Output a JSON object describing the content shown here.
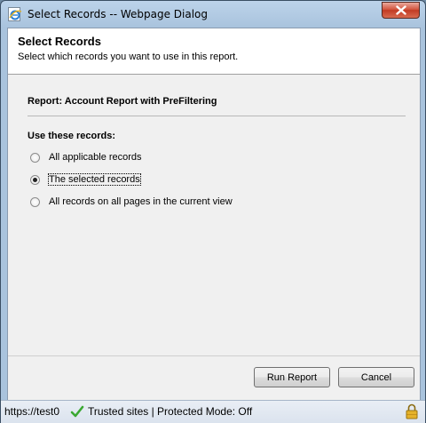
{
  "window": {
    "title": "Select Records -- Webpage Dialog"
  },
  "header": {
    "title": "Select Records",
    "description": "Select which records you want to use in this report."
  },
  "report": {
    "label": "Report: Account Report with PreFiltering"
  },
  "records": {
    "heading": "Use these records:",
    "options": [
      {
        "label": "All applicable records",
        "checked": false
      },
      {
        "label": "The selected records",
        "checked": true
      },
      {
        "label": "All records on all pages in the current view",
        "checked": false
      }
    ]
  },
  "buttons": {
    "run_report": "Run Report",
    "cancel": "Cancel"
  },
  "status": {
    "url": "https://test0",
    "zone": "Trusted sites | Protected Mode: Off"
  },
  "icons": {
    "title_icon": "ie-icon",
    "close": "close-icon",
    "check": "check-icon",
    "lock": "lock-icon"
  },
  "colors": {
    "close_button": "#c23b23",
    "trusted_check": "#3aa832",
    "lock": "#d9a21b"
  }
}
